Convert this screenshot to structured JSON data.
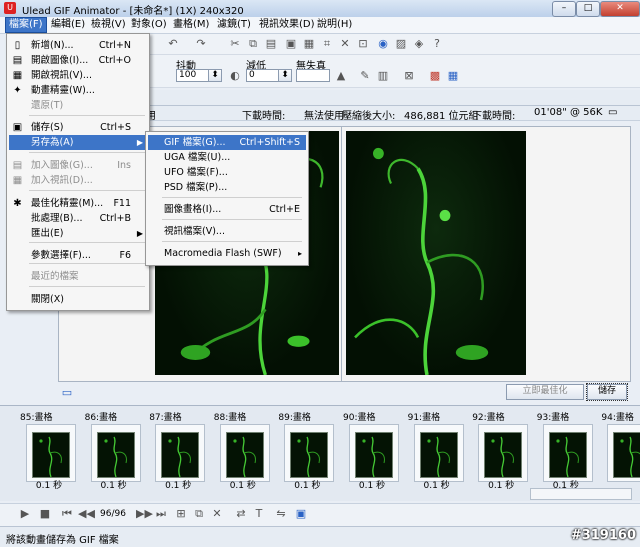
{
  "window": {
    "title": "Ulead GIF Animator - [未命名*] (1X) 240x320",
    "min": "–",
    "max": "□",
    "close": "✕"
  },
  "menubar": [
    "檔案(F)",
    "編輯(E)",
    "檢視(V)",
    "對象(O)",
    "畫格(M)",
    "濾鏡(T)",
    "視訊效果(D)",
    "說明(H)"
  ],
  "toolbar2": {
    "jitter_label": "抖動",
    "jitter_value": "100",
    "reduce_label": "減低",
    "reduce_value": "0",
    "noloss_label": "無失真"
  },
  "info": {
    "dl_time_label": "下載時間:",
    "dl_time_value": "無法使用",
    "compressed_label": "壓縮後大小:",
    "compressed_value": "486,881 位元組",
    "dl_time2_label": "下載時間:",
    "dl_time2_value": "01'08\" @ 56K",
    "left_cut": "用"
  },
  "buttons": {
    "optimize": "立即最佳化",
    "save": "儲存"
  },
  "file_menu": [
    {
      "icon": "new-icon",
      "label": "新增(N)...",
      "shortcut": "Ctrl+N",
      "enabled": true
    },
    {
      "icon": "open-image-icon",
      "label": "開啟圖像(I)...",
      "shortcut": "Ctrl+O",
      "enabled": true
    },
    {
      "icon": "open-video-icon",
      "label": "開啟視訊(V)...",
      "shortcut": "",
      "enabled": true
    },
    {
      "icon": "animation-wizard-icon",
      "label": "動畫精靈(W)...",
      "shortcut": "",
      "enabled": true
    },
    {
      "icon": "",
      "label": "還原(T)",
      "shortcut": "",
      "enabled": false
    },
    {
      "icon": "save-icon",
      "label": "儲存(S)",
      "shortcut": "Ctrl+S",
      "enabled": true
    },
    {
      "icon": "",
      "label": "另存為(A)",
      "shortcut": "",
      "enabled": true,
      "submenu": true
    },
    {
      "icon": "add-image-icon",
      "label": "加入圖像(G)...",
      "shortcut": "Ins",
      "enabled": false
    },
    {
      "icon": "add-video-icon",
      "label": "加入視訊(D)...",
      "shortcut": "",
      "enabled": false
    },
    {
      "icon": "optimize-wizard-icon",
      "label": "最佳化精靈(M)...",
      "shortcut": "F11",
      "enabled": true
    },
    {
      "icon": "",
      "label": "批處理(B)...",
      "shortcut": "Ctrl+B",
      "enabled": true,
      "submenu": false
    },
    {
      "icon": "",
      "label": "匯出(E)",
      "shortcut": "",
      "enabled": true,
      "submenu": true
    },
    {
      "icon": "",
      "label": "參數選擇(F)...",
      "shortcut": "F6",
      "enabled": true
    },
    {
      "icon": "",
      "label": "最近的檔案",
      "shortcut": "",
      "enabled": false
    },
    {
      "icon": "",
      "label": "關閉(X)",
      "shortcut": "",
      "enabled": true
    }
  ],
  "saveas_menu": [
    {
      "label": "GIF 檔案(G)...",
      "shortcut": "Ctrl+Shift+S"
    },
    {
      "label": "UGA 檔案(U)...",
      "shortcut": ""
    },
    {
      "label": "UFO 檔案(F)...",
      "shortcut": ""
    },
    {
      "label": "PSD 檔案(P)...",
      "shortcut": ""
    },
    {
      "label": "圖像畫格(I)...",
      "shortcut": "Ctrl+E"
    },
    {
      "label": "視訊檔案(V)...",
      "shortcut": ""
    },
    {
      "label": "Macromedia Flash (SWF)",
      "shortcut": "",
      "arrow": "▸"
    }
  ],
  "frames": [
    {
      "label": "85:畫格",
      "time": "0.1 秒"
    },
    {
      "label": "86:畫格",
      "time": "0.1 秒"
    },
    {
      "label": "87:畫格",
      "time": "0.1 秒"
    },
    {
      "label": "88:畫格",
      "time": "0.1 秒"
    },
    {
      "label": "89:畫格",
      "time": "0.1 秒"
    },
    {
      "label": "90:畫格",
      "time": "0.1 秒"
    },
    {
      "label": "91:畫格",
      "time": "0.1 秒"
    },
    {
      "label": "92:畫格",
      "time": "0.1 秒"
    },
    {
      "label": "93:畫格",
      "time": "0.1 秒"
    },
    {
      "label": "94:畫格",
      "time": ""
    }
  ],
  "playback": {
    "counter": "96/96"
  },
  "status": {
    "text": "將該動畫儲存為 GIF 檔案"
  },
  "watermark": "#319160"
}
